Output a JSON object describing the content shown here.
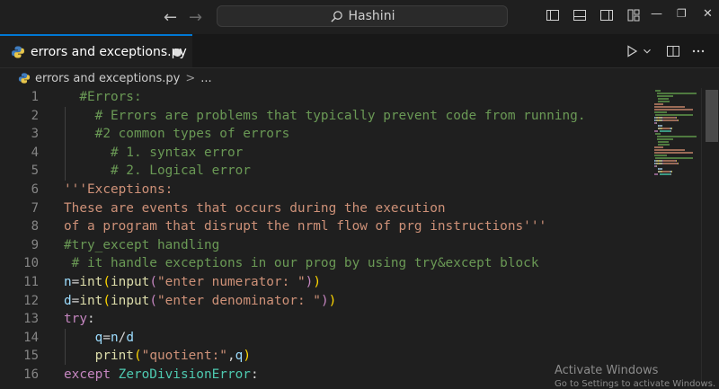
{
  "titlebar": {
    "search_text": "Hashini",
    "icons": [
      "back-arrow-icon",
      "forward-arrow-icon",
      "search-icon",
      "toggle-primary-sidebar-icon",
      "toggle-panel-icon",
      "toggle-secondary-sidebar-icon",
      "customize-layout-icon",
      "minimize-icon",
      "restore-icon",
      "close-icon"
    ]
  },
  "tab": {
    "label": "errors and exceptions.py",
    "modified": true
  },
  "breadcrumb": {
    "file": "errors and exceptions.py",
    "separator": ">",
    "more": "..."
  },
  "editor": {
    "line_numbers": [
      "1",
      "2",
      "3",
      "4",
      "5",
      "6",
      "7",
      "8",
      "9",
      "10",
      "11",
      "12",
      "13",
      "14",
      "15",
      "16"
    ],
    "lines": [
      [
        [
          "comment",
          "  #Errors:"
        ]
      ],
      [
        [
          "comment",
          "    # Errors are problems that typically prevent code from running."
        ]
      ],
      [
        [
          "comment",
          "    #2 common types of errors"
        ]
      ],
      [
        [
          "comment",
          "      # 1. syntax error"
        ]
      ],
      [
        [
          "comment",
          "      # 2. Logical error"
        ]
      ],
      [
        [
          "string",
          "'''Exceptions:"
        ]
      ],
      [
        [
          "string",
          "These are events that occurs during the execution"
        ]
      ],
      [
        [
          "string",
          "of a program that disrupt the nrml flow of prg instructions'''"
        ]
      ],
      [
        [
          "comment",
          "#try_except handling"
        ]
      ],
      [
        [
          "comment",
          " # it handle exceptions in our prog by using try&except block"
        ]
      ],
      [
        [
          "var",
          "n"
        ],
        [
          "default",
          "="
        ],
        [
          "builtin",
          "int"
        ],
        [
          "paren",
          "("
        ],
        [
          "builtin",
          "input"
        ],
        [
          "paren2",
          "("
        ],
        [
          "string",
          "\"enter numerator: \""
        ],
        [
          "paren2",
          ")"
        ],
        [
          "paren",
          ")"
        ]
      ],
      [
        [
          "var",
          "d"
        ],
        [
          "default",
          "="
        ],
        [
          "builtin",
          "int"
        ],
        [
          "paren",
          "("
        ],
        [
          "builtin",
          "input"
        ],
        [
          "paren2",
          "("
        ],
        [
          "string",
          "\"enter denominator: \""
        ],
        [
          "paren2",
          ")"
        ],
        [
          "paren",
          ")"
        ]
      ],
      [
        [
          "keyword",
          "try"
        ],
        [
          "default",
          ":"
        ]
      ],
      [
        [
          "default",
          "    "
        ],
        [
          "var",
          "q"
        ],
        [
          "default",
          "="
        ],
        [
          "var",
          "n"
        ],
        [
          "default",
          "/"
        ],
        [
          "var",
          "d"
        ]
      ],
      [
        [
          "default",
          "    "
        ],
        [
          "builtin",
          "print"
        ],
        [
          "paren",
          "("
        ],
        [
          "string",
          "\"quotient:\""
        ],
        [
          "default",
          ","
        ],
        [
          "var",
          "q"
        ],
        [
          "paren",
          ")"
        ]
      ],
      [
        [
          "keyword",
          "except"
        ],
        [
          "default",
          " "
        ],
        [
          "class",
          "ZeroDivisionError"
        ],
        [
          "default",
          ":"
        ]
      ]
    ]
  },
  "watermark": {
    "line1": "Activate Windows",
    "line2": "Go to Settings to activate Windows."
  },
  "colors": {
    "accent": "#0078d4",
    "comment": "#6a9955",
    "string": "#ce9178",
    "keyword": "#c586c0"
  }
}
